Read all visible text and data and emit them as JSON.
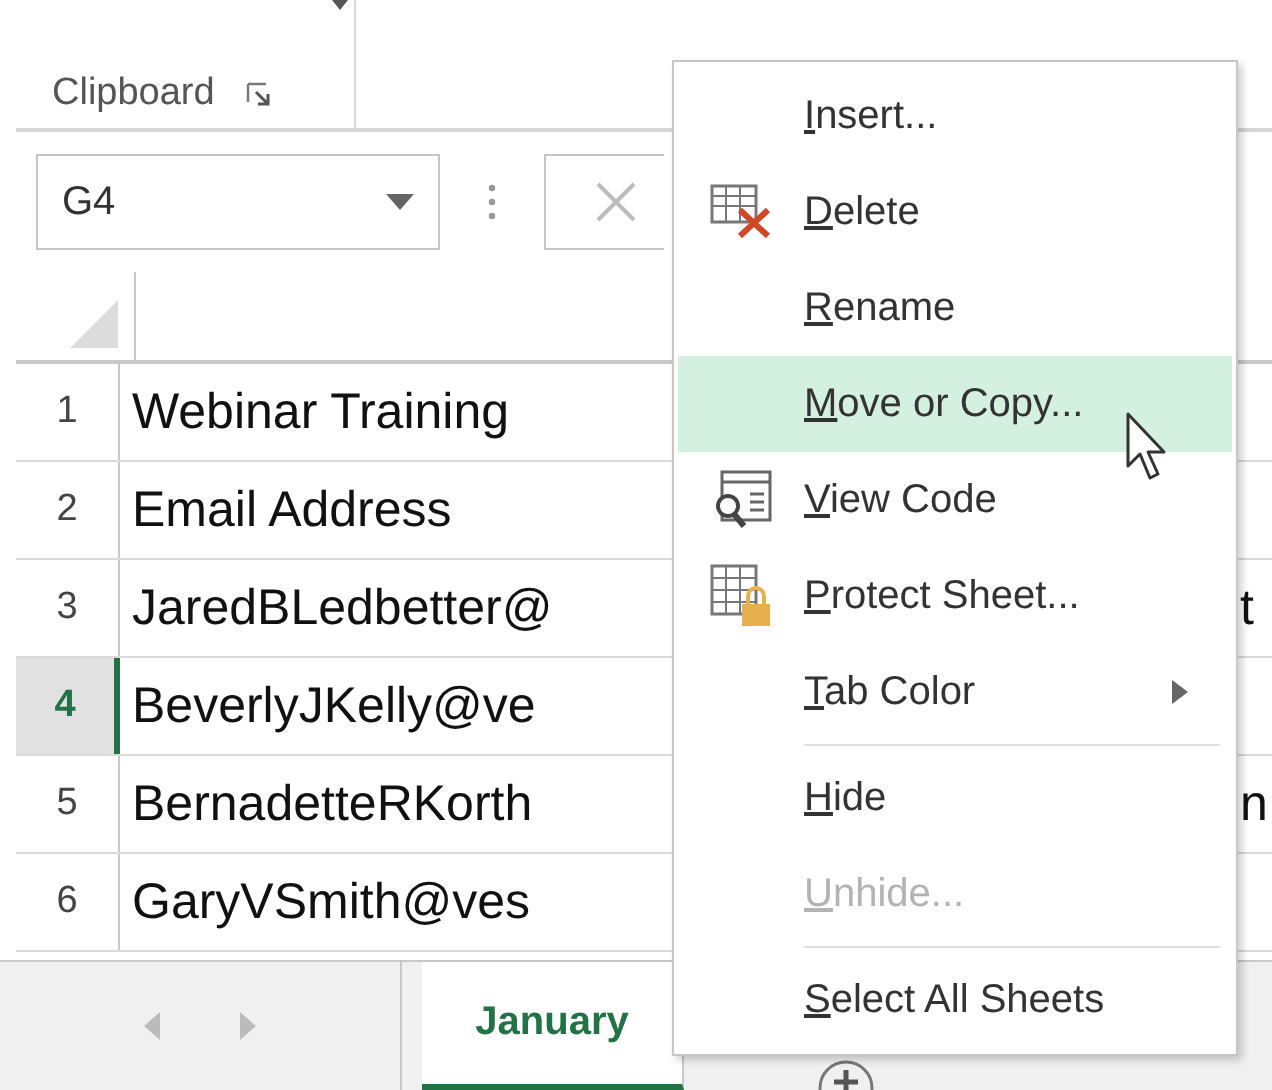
{
  "ribbon": {
    "group_label": "Clipboard"
  },
  "formula_bar": {
    "name_box": "G4"
  },
  "sheet": {
    "rows": [
      {
        "header": "1",
        "cell": "Webinar Training",
        "right_cell": "",
        "selected": false
      },
      {
        "header": "2",
        "cell": "Email Address",
        "right_cell": "",
        "selected": false
      },
      {
        "header": "3",
        "cell": "JaredBLedbetter@",
        "right_cell": "t",
        "selected": false
      },
      {
        "header": "4",
        "cell": "BeverlyJKelly@ve",
        "right_cell": "",
        "selected": true
      },
      {
        "header": "5",
        "cell": "BernadetteRKorth",
        "right_cell": "n",
        "selected": false
      },
      {
        "header": "6",
        "cell": "GaryVSmith@ves",
        "right_cell": "",
        "selected": false
      }
    ]
  },
  "sheet_tabs": [
    {
      "label": "January",
      "selected": true
    }
  ],
  "context_menu": {
    "items": [
      {
        "label": "Insert...",
        "kind": "plain",
        "selected": false,
        "disabled": false,
        "submenu": false,
        "separator_after": false
      },
      {
        "label": "Delete",
        "kind": "delete",
        "selected": false,
        "disabled": false,
        "submenu": false,
        "separator_after": false
      },
      {
        "label": "Rename",
        "kind": "plain",
        "selected": false,
        "disabled": false,
        "submenu": false,
        "separator_after": false
      },
      {
        "label": "Move or Copy...",
        "kind": "plain",
        "selected": true,
        "disabled": false,
        "submenu": false,
        "separator_after": false
      },
      {
        "label": "View Code",
        "kind": "code",
        "selected": false,
        "disabled": false,
        "submenu": false,
        "separator_after": false
      },
      {
        "label": "Protect Sheet...",
        "kind": "protect",
        "selected": false,
        "disabled": false,
        "submenu": false,
        "separator_after": false
      },
      {
        "label": "Tab Color",
        "kind": "plain",
        "selected": false,
        "disabled": false,
        "submenu": true,
        "separator_after": true
      },
      {
        "label": "Hide",
        "kind": "plain",
        "selected": false,
        "disabled": false,
        "submenu": false,
        "separator_after": false
      },
      {
        "label": "Unhide...",
        "kind": "plain",
        "selected": false,
        "disabled": true,
        "submenu": false,
        "separator_after": true
      },
      {
        "label": "Select All Sheets",
        "kind": "plain",
        "selected": false,
        "disabled": false,
        "submenu": false,
        "separator_after": false
      }
    ]
  }
}
